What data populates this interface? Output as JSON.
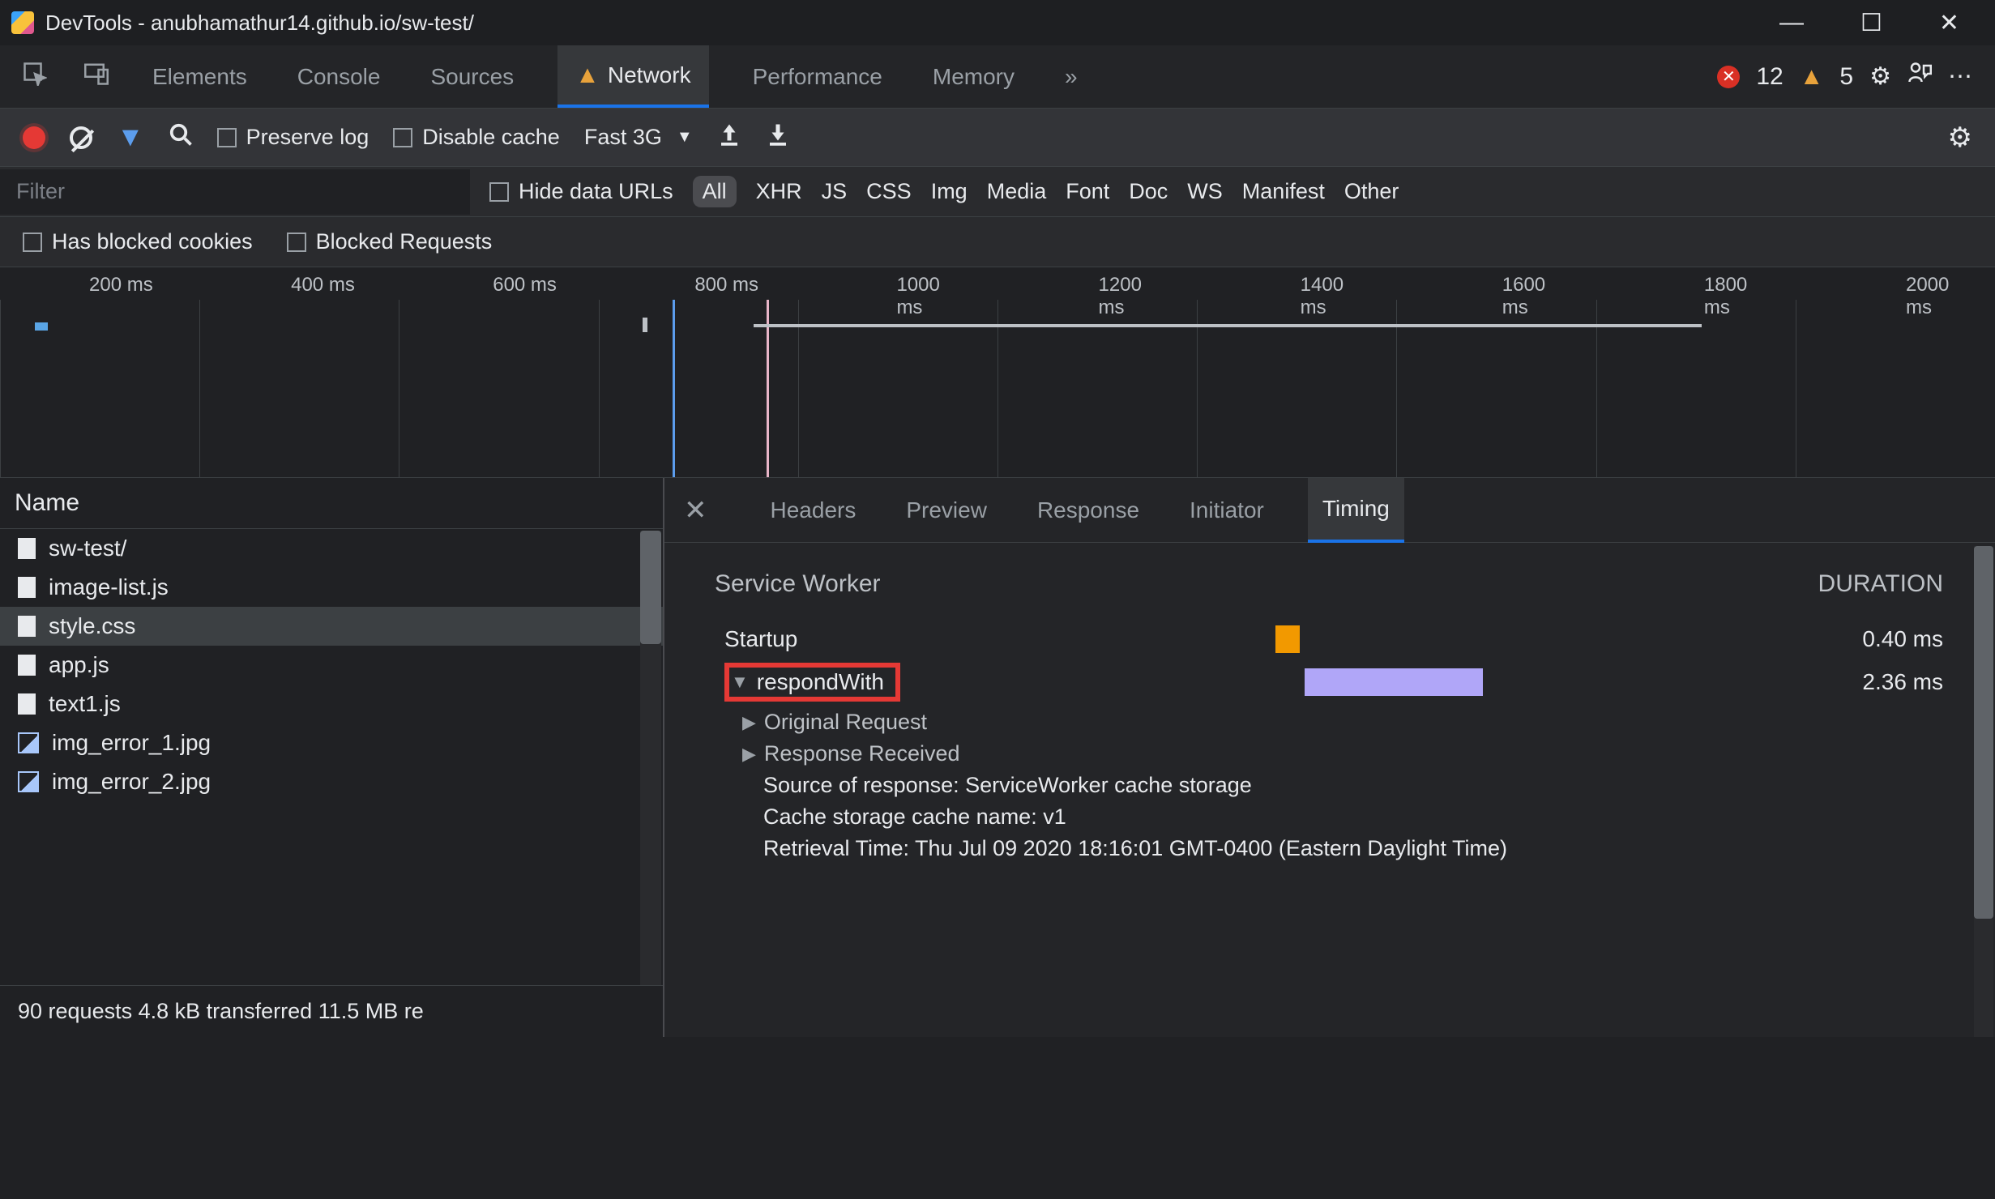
{
  "window": {
    "title": "DevTools - anubhamathur14.github.io/sw-test/"
  },
  "tabs": {
    "elements": "Elements",
    "console": "Console",
    "sources": "Sources",
    "network": "Network",
    "performance": "Performance",
    "memory": "Memory"
  },
  "counters": {
    "errors": "12",
    "warnings": "5"
  },
  "toolbar": {
    "preserve_log": "Preserve log",
    "disable_cache": "Disable cache",
    "throttling": "Fast 3G"
  },
  "filter": {
    "placeholder": "Filter",
    "hide_data_urls": "Hide data URLs",
    "types": [
      "All",
      "XHR",
      "JS",
      "CSS",
      "Img",
      "Media",
      "Font",
      "Doc",
      "WS",
      "Manifest",
      "Other"
    ],
    "has_blocked_cookies": "Has blocked cookies",
    "blocked_requests": "Blocked Requests"
  },
  "timeline_ticks": [
    "200 ms",
    "400 ms",
    "600 ms",
    "800 ms",
    "1000 ms",
    "1200 ms",
    "1400 ms",
    "1600 ms",
    "1800 ms",
    "2000 ms"
  ],
  "name_header": "Name",
  "files": [
    {
      "name": "sw-test/",
      "type": "doc"
    },
    {
      "name": "image-list.js",
      "type": "doc"
    },
    {
      "name": "style.css",
      "type": "doc",
      "selected": true
    },
    {
      "name": "app.js",
      "type": "doc"
    },
    {
      "name": "text1.js",
      "type": "doc"
    },
    {
      "name": "img_error_1.jpg",
      "type": "img"
    },
    {
      "name": "img_error_2.jpg",
      "type": "img"
    }
  ],
  "status": "90 requests  4.8 kB transferred  11.5 MB re",
  "detail_tabs": {
    "headers": "Headers",
    "preview": "Preview",
    "response": "Response",
    "initiator": "Initiator",
    "timing": "Timing"
  },
  "timing": {
    "section_title": "Service Worker",
    "duration_header": "DURATION",
    "startup_label": "Startup",
    "startup_duration": "0.40 ms",
    "respondwith_label": "respondWith",
    "respondwith_duration": "2.36 ms",
    "original_request": "Original Request",
    "response_received": "Response Received",
    "source_line": "Source of response: ServiceWorker cache storage",
    "cache_line": "Cache storage cache name: v1",
    "retrieval_line": "Retrieval Time: Thu Jul 09 2020 18:16:01 GMT-0400 (Eastern Daylight Time)"
  }
}
